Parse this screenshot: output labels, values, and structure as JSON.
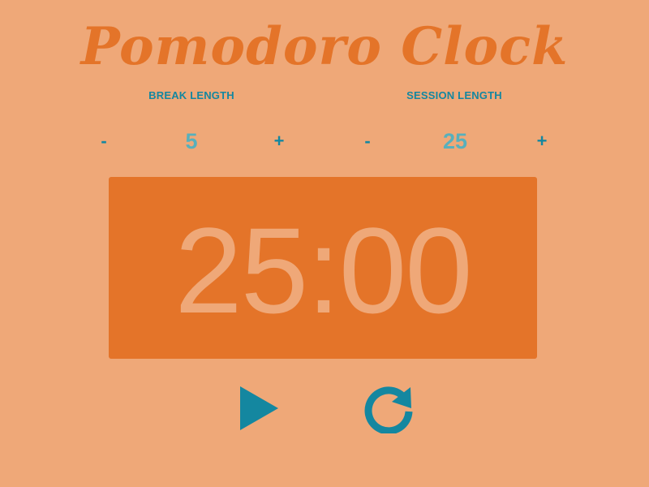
{
  "app": {
    "title": "Pomodoro Clock"
  },
  "break": {
    "label": "BREAK LENGTH",
    "decrement_label": "-",
    "value": "5",
    "increment_label": "+"
  },
  "session": {
    "label": "SESSION LENGTH",
    "decrement_label": "-",
    "value": "25",
    "increment_label": "+"
  },
  "timer": {
    "display": "25:00"
  },
  "controls": {
    "play_icon": "play-icon",
    "reset_icon": "reset-icon"
  },
  "colors": {
    "background": "#EFA878",
    "accent": "#E47429",
    "control": "#1487A0",
    "value_text": "#58B0BC"
  }
}
